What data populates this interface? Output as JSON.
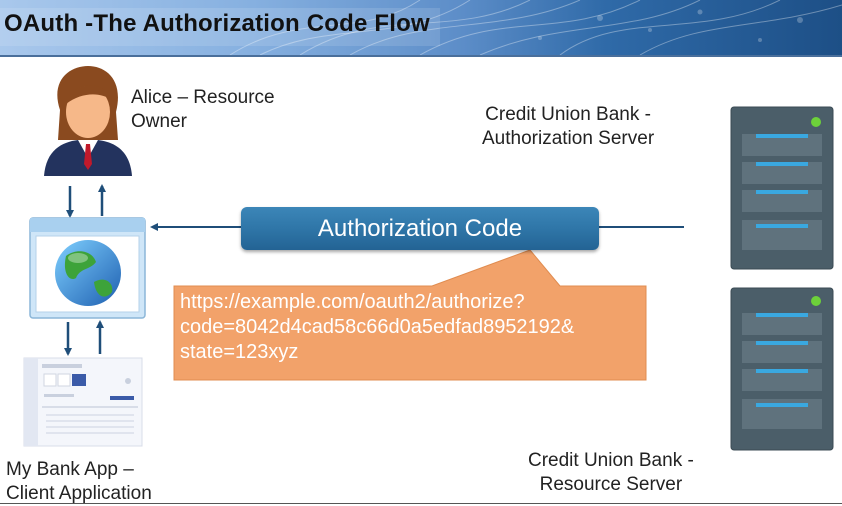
{
  "header": {
    "title": "OAuth -The Authorization Code Flow"
  },
  "actors": {
    "resource_owner": {
      "line1": "Alice – Resource",
      "line2": "Owner"
    },
    "authorization_server": {
      "line1": "Credit Union  Bank -",
      "line2": "Authorization Server"
    },
    "resource_server": {
      "line1": "Credit Union  Bank -",
      "line2": "Resource Server"
    },
    "client": {
      "line1": "My Bank App –",
      "line2": "Client Application"
    }
  },
  "message": {
    "label": "Authorization Code"
  },
  "callout": {
    "line1": "https://example.com/oauth2/authorize?",
    "line2": "code=8042d4cad58c66d0a5edfad8952192&",
    "line3": "state=123xyz"
  },
  "colors": {
    "auth_code_box": "#2f76a8",
    "callout": "#f2a26a",
    "arrow": "#1f4e79",
    "server_body": "#4b5e69",
    "server_led": "#6dd13a",
    "server_slot": "#3aa8e0"
  }
}
